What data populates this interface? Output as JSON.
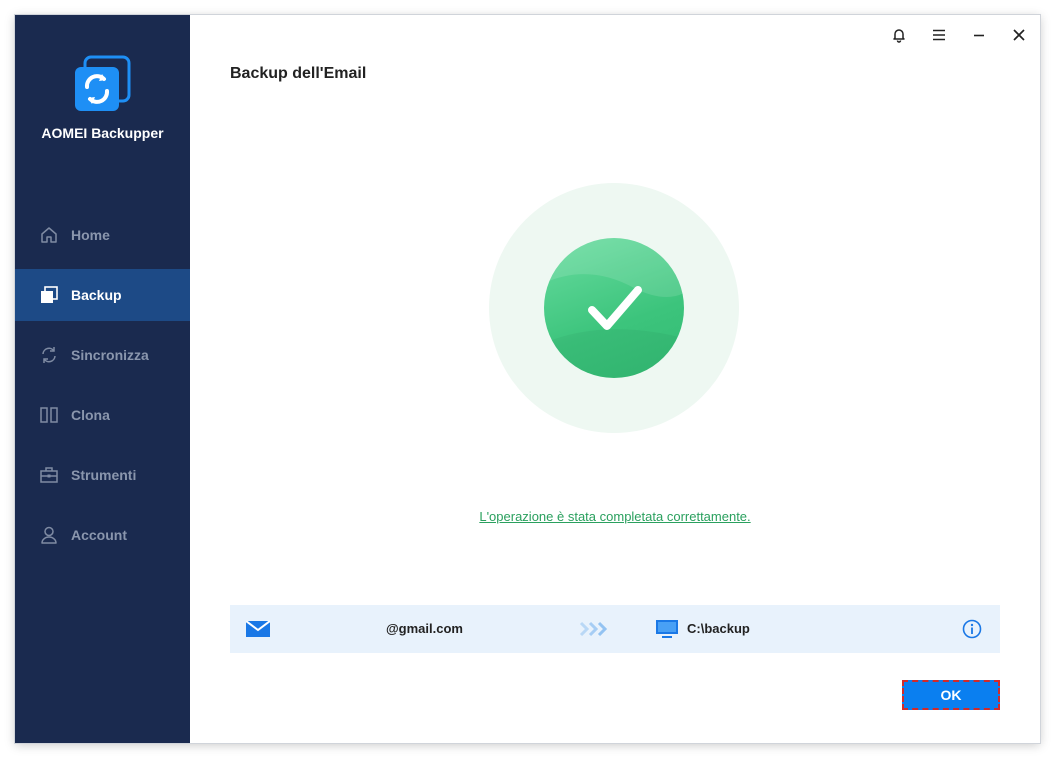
{
  "app": {
    "name": "AOMEI Backupper"
  },
  "sidebar": {
    "items": [
      {
        "label": "Home",
        "icon": "home-icon",
        "active": false
      },
      {
        "label": "Backup",
        "icon": "backup-icon",
        "active": true
      },
      {
        "label": "Sincronizza",
        "icon": "sync-icon",
        "active": false
      },
      {
        "label": "Clona",
        "icon": "clone-icon",
        "active": false
      },
      {
        "label": "Strumenti",
        "icon": "toolbox-icon",
        "active": false
      },
      {
        "label": "Account",
        "icon": "user-icon",
        "active": false
      }
    ]
  },
  "titlebar": {
    "icons": [
      "bell-icon",
      "menu-icon",
      "minimize-icon",
      "close-icon"
    ]
  },
  "main": {
    "title": "Backup dell'Email",
    "status_message": "L'operazione è stata completata correttamente.",
    "backup": {
      "source": "@gmail.com",
      "destination": "C:\\backup"
    },
    "ok_label": "OK"
  },
  "colors": {
    "sidebar_bg": "#1a2a4f",
    "sidebar_active": "#1d4a86",
    "accent": "#0a7ff0",
    "success": "#3cc47c",
    "success_text": "#2aa05e",
    "row_bg": "#e8f2fc"
  }
}
